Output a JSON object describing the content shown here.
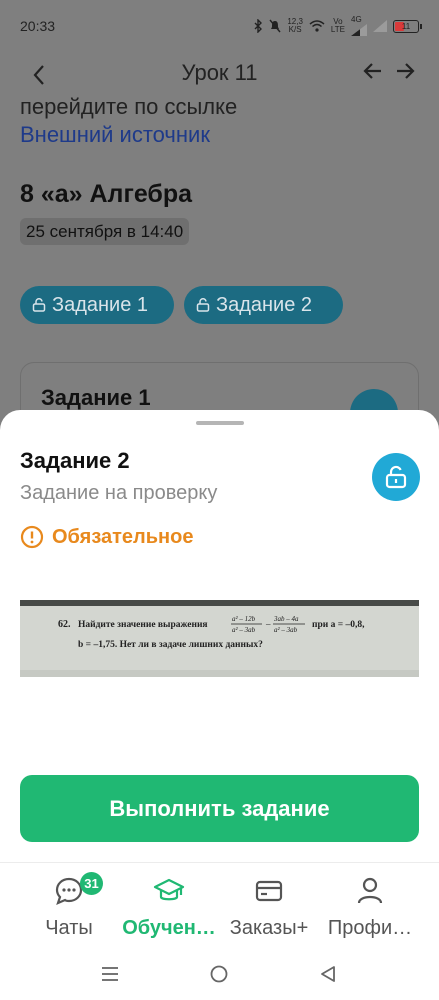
{
  "status_bar": {
    "time": "20:33",
    "net_speed": "12,3",
    "net_unit": "K/S",
    "volte_top": "Vo",
    "volte_bottom": "LTE",
    "network": "4G",
    "battery": "11"
  },
  "header": {
    "title": "Урок 11"
  },
  "background": {
    "instruction_text": "перейдите по ссылке",
    "link_text": "Внешний источник",
    "lesson_title": "8 «а» Алгебра",
    "date": "25 сентября в 14:40",
    "chips": [
      {
        "label": "Задание 1"
      },
      {
        "label": "Задание 2"
      }
    ],
    "card_title": "Задание 1"
  },
  "sheet": {
    "title": "Задание 2",
    "subtitle": "Задание на проверку",
    "required_label": "Обязательное",
    "accent_color": "#21a9d6",
    "warning_color": "#e8891d",
    "image": {
      "number": "62.",
      "text_line1": "Найдите значение выражения",
      "frac1_num": "a² – 12b",
      "frac1_den": "a² – 3ab",
      "frac2_num": "3ab – 4a",
      "frac2_den": "a² – 3ab",
      "condition": "при a = –0,8,",
      "text_line2": "b = –1,75. Нет ли в задаче лишних данных?"
    },
    "action_button": "Выполнить задание",
    "action_color": "#20b873"
  },
  "tabs": [
    {
      "label": "Чаты",
      "icon": "chat-icon",
      "badge": "31"
    },
    {
      "label": "Обучен…",
      "icon": "graduation-cap-icon",
      "active": true
    },
    {
      "label": "Заказы+",
      "icon": "card-icon"
    },
    {
      "label": "Профи…",
      "icon": "profile-icon"
    }
  ]
}
